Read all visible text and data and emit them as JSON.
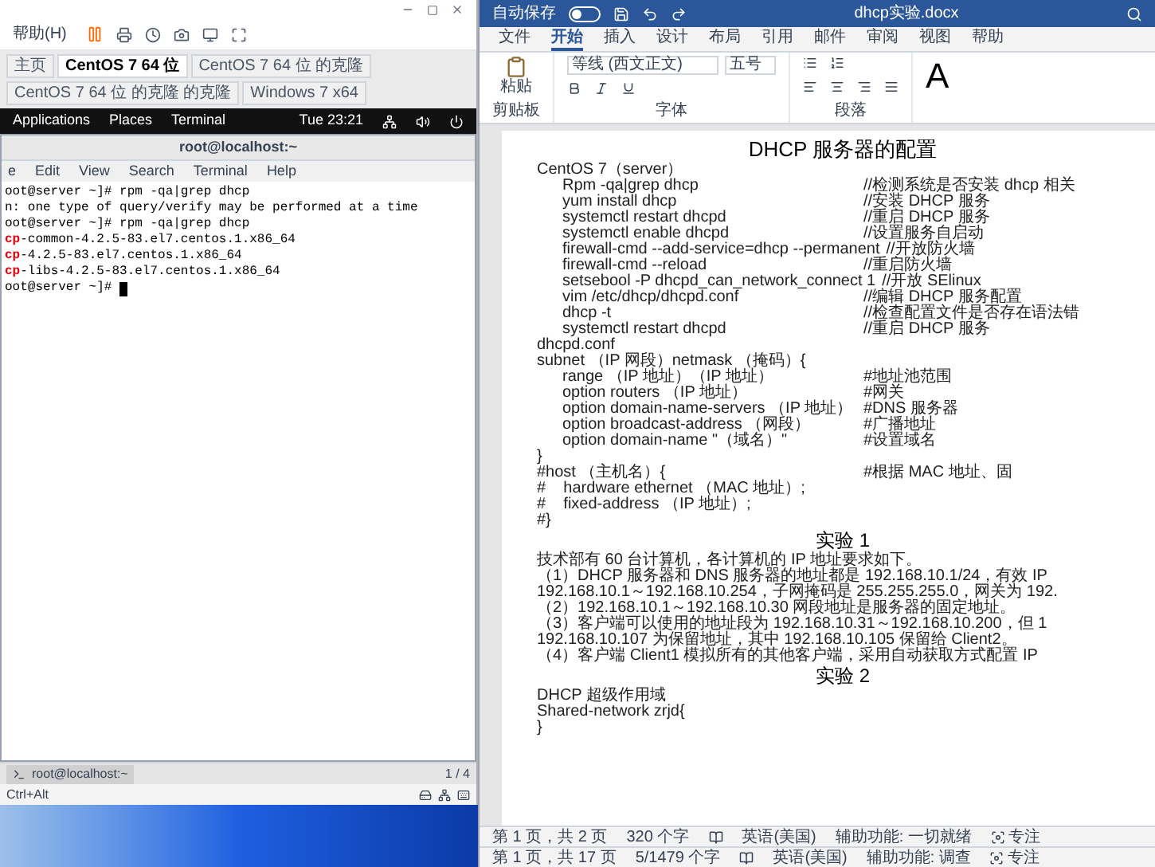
{
  "vm_window": {
    "toolbar": {
      "help_menu": "帮助(H)"
    },
    "tabs": [
      {
        "label": "主页",
        "selected": false
      },
      {
        "label": "CentOS 7 64 位",
        "selected": true
      },
      {
        "label": "CentOS 7 64 位 的克隆",
        "selected": false
      },
      {
        "label": "CentOS 7 64 位 的克隆 的克隆",
        "selected": false
      },
      {
        "label": "Windows 7 x64",
        "selected": false
      }
    ],
    "guest_top_bar": {
      "menus": [
        "Applications",
        "Places",
        "Terminal"
      ],
      "clock": "Tue 23:21"
    },
    "terminal": {
      "title": "root@localhost:~",
      "menu": [
        "e",
        "Edit",
        "View",
        "Search",
        "Terminal",
        "Help"
      ],
      "lines": [
        {
          "text": "oot@server ~]# rpm -qa|grep dhcp"
        },
        {
          "text": "n: one type of query/verify may be performed at a time"
        },
        {
          "text": "oot@server ~]# rpm -qa|grep dhcp"
        },
        {
          "highlight": "cp",
          "text": "-common-4.2.5-83.el7.centos.1.x86_64"
        },
        {
          "highlight": "cp",
          "text": "-4.2.5-83.el7.centos.1.x86_64"
        },
        {
          "highlight": "cp",
          "text": "-libs-4.2.5-83.el7.centos.1.x86_64"
        },
        {
          "text": "oot@server ~]# ",
          "cursor": true
        }
      ]
    },
    "taskbar": {
      "item": "root@localhost:~",
      "workspace": "1 / 4"
    },
    "status_bar": {
      "hint": "Ctrl+Alt"
    }
  },
  "word_window": {
    "autosave": {
      "label": "自动保存",
      "on": false
    },
    "filename": "dhcp实验.docx",
    "tabs": [
      {
        "label": "文件",
        "selected": false
      },
      {
        "label": "开始",
        "selected": true
      },
      {
        "label": "插入",
        "selected": false
      },
      {
        "label": "设计",
        "selected": false
      },
      {
        "label": "布局",
        "selected": false
      },
      {
        "label": "引用",
        "selected": false
      },
      {
        "label": "邮件",
        "selected": false
      },
      {
        "label": "审阅",
        "selected": false
      },
      {
        "label": "视图",
        "selected": false
      },
      {
        "label": "帮助",
        "selected": false
      }
    ],
    "ribbon": {
      "paste": "粘贴",
      "clipboard_label": "剪贴板",
      "font_name": "等线 (西文正文)",
      "font_size": "五号",
      "font_label": "字体",
      "paragraph_label": "段落",
      "styles_preview": "A"
    },
    "document": [
      {
        "kind": "title",
        "text": "DHCP 服务器的配置"
      },
      {
        "kind": "line",
        "text": "CentOS 7（server）"
      },
      {
        "kind": "item",
        "text": "Rpm -qa|grep dhcp",
        "comment": "//检测系统是否安装 dhcp 相关"
      },
      {
        "kind": "item",
        "text": "yum install dhcp",
        "comment": "//安装 DHCP 服务"
      },
      {
        "kind": "item",
        "text": "systemctl restart dhcpd",
        "comment": "//重启 DHCP 服务"
      },
      {
        "kind": "item",
        "text": "systemctl enable dhcpd",
        "comment": "//设置服务自启动"
      },
      {
        "kind": "item",
        "text": "firewall-cmd --add-service=dhcp --permanent",
        "comment": "//开放防火墙"
      },
      {
        "kind": "item",
        "text": "firewall-cmd --reload",
        "comment": "//重启防火墙"
      },
      {
        "kind": "item",
        "text": "setsebool -P dhcpd_can_network_connect 1",
        "comment": "//开放 SElinux"
      },
      {
        "kind": "item",
        "text": "vim /etc/dhcp/dhcpd.conf",
        "comment": "//编辑 DHCP 服务配置"
      },
      {
        "kind": "item",
        "text": "dhcp -t",
        "comment": "//检查配置文件是否存在语法错"
      },
      {
        "kind": "item",
        "text": "systemctl restart dhcpd",
        "comment": "//重启 DHCP 服务"
      },
      {
        "kind": "line",
        "text": "dhcpd.conf"
      },
      {
        "kind": "line",
        "text": "subnet （IP 网段）netmask （掩码）{"
      },
      {
        "kind": "item",
        "text": "range （IP 地址）（IP 地址）",
        "comment": "#地址池范围"
      },
      {
        "kind": "item",
        "text": "option routers （IP 地址）",
        "comment": "#网关"
      },
      {
        "kind": "item",
        "text": "option domain-name-servers （IP 地址）",
        "comment": "#DNS 服务器"
      },
      {
        "kind": "item",
        "text": "option broadcast-address （网段）",
        "comment": "#广播地址"
      },
      {
        "kind": "item",
        "text": "option domain-name \"（域名）\"",
        "comment": "#设置域名"
      },
      {
        "kind": "line",
        "text": "}"
      },
      {
        "kind": "line",
        "text": "#host （主机名）{",
        "comment": "#根据 MAC 地址、固"
      },
      {
        "kind": "line",
        "text": "#    hardware ethernet （MAC 地址）;"
      },
      {
        "kind": "line",
        "text": "#    fixed-address （IP 地址）;"
      },
      {
        "kind": "line",
        "text": "#}"
      },
      {
        "kind": "heading",
        "text": "实验 1"
      },
      {
        "kind": "line",
        "text": "技术部有 60 台计算机，各计算机的 IP 地址要求如下。"
      },
      {
        "kind": "line",
        "text": "（1）DHCP 服务器和 DNS 服务器的地址都是 192.168.10.1/24，有效 IP"
      },
      {
        "kind": "line",
        "text": "192.168.10.1～192.168.10.254，子网掩码是 255.255.255.0，网关为 192."
      },
      {
        "kind": "line",
        "text": "（2）192.168.10.1～192.168.10.30 网段地址是服务器的固定地址。"
      },
      {
        "kind": "line",
        "text": "（3）客户端可以使用的地址段为 192.168.10.31～192.168.10.200，但 1"
      },
      {
        "kind": "line",
        "text": "192.168.10.107 为保留地址，其中 192.168.10.105 保留给 Client2。"
      },
      {
        "kind": "line",
        "text": "（4）客户端 Client1 模拟所有的其他客户端，采用自动获取方式配置 IP"
      },
      {
        "kind": "heading",
        "text": "实验 2"
      },
      {
        "kind": "line",
        "text": "DHCP 超级作用域"
      },
      {
        "kind": "line",
        "text": "Shared-network zrjd{"
      },
      {
        "kind": "line",
        "text": "}"
      }
    ],
    "status_bars": [
      {
        "page": "第 1 页，共 2 页",
        "words": "320 个字",
        "language": "英语(美国)",
        "accessibility": "辅助功能: 一切就绪",
        "focus": "专注"
      },
      {
        "page": "第 1 页，共 17 页",
        "words": "5/1479 个字",
        "language": "英语(美国)",
        "accessibility": "辅助功能: 调查",
        "focus": "专注"
      }
    ]
  }
}
